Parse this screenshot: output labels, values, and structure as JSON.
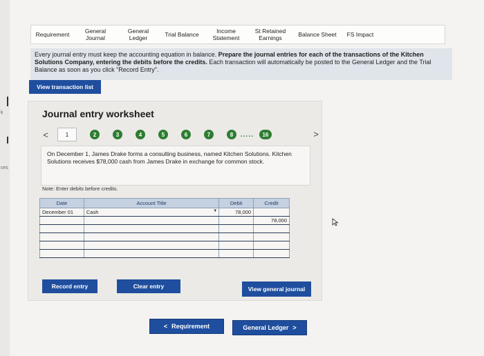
{
  "left_edge": {
    "fragments": [
      "k",
      "ces"
    ]
  },
  "tabs": [
    {
      "label1": "Requirement",
      "label2": ""
    },
    {
      "label1": "General",
      "label2": "Journal"
    },
    {
      "label1": "General",
      "label2": "Ledger"
    },
    {
      "label1": "Trial Balance",
      "label2": ""
    },
    {
      "label1": "Income",
      "label2": "Statement"
    },
    {
      "label1": "St Retained",
      "label2": "Earnings"
    },
    {
      "label1": "Balance Sheet",
      "label2": ""
    },
    {
      "label1": "FS Impact",
      "label2": ""
    }
  ],
  "instructions": {
    "part1": "Every journal entry must keep the accounting equation in balance. ",
    "bold": "Prepare the journal entries for each of the transactions of the Kitchen Solutions Company, entering the debits before the credits.",
    "part2": " Each transaction will automatically be posted to the General Ledger and the Trial Balance as soon as you click \"Record Entry\"."
  },
  "view_transaction_list": "View transaction list",
  "worksheet": {
    "title": "Journal entry worksheet",
    "pager": {
      "prev": "<",
      "next": ">",
      "current": "1",
      "pages": [
        "2",
        "3",
        "4",
        "5",
        "6",
        "7",
        "8"
      ],
      "ellipsis": ".....",
      "last": "16"
    },
    "description": "On December 1, James Drake forms a consulting business, named Kitchen Solutions. Kitchen Solutions receives $78,000 cash from James Drake in exchange for common stock.",
    "note": "Note: Enter debits before credits.",
    "table": {
      "headers": {
        "date": "Date",
        "account": "Account Title",
        "debit": "Debit",
        "credit": "Credit"
      },
      "rows": [
        {
          "date": "December 01",
          "account": "Cash",
          "debit": "78,000",
          "credit": ""
        },
        {
          "date": "",
          "account": "",
          "debit": "",
          "credit": "78,000"
        },
        {
          "date": "",
          "account": "",
          "debit": "",
          "credit": ""
        },
        {
          "date": "",
          "account": "",
          "debit": "",
          "credit": ""
        },
        {
          "date": "",
          "account": "",
          "debit": "",
          "credit": ""
        },
        {
          "date": "",
          "account": "",
          "debit": "",
          "credit": ""
        }
      ]
    },
    "record_entry": "Record entry",
    "clear_entry": "Clear entry",
    "view_general_journal": "View general journal"
  },
  "nav": {
    "prev_label": "Requirement",
    "prev_glyph": "<",
    "next_label": "General Ledger",
    "next_glyph": ">"
  },
  "colors": {
    "accent_blue": "#1f4e9e",
    "step_green": "#2e7d32",
    "instructions_bg": "#dfe5ea"
  }
}
